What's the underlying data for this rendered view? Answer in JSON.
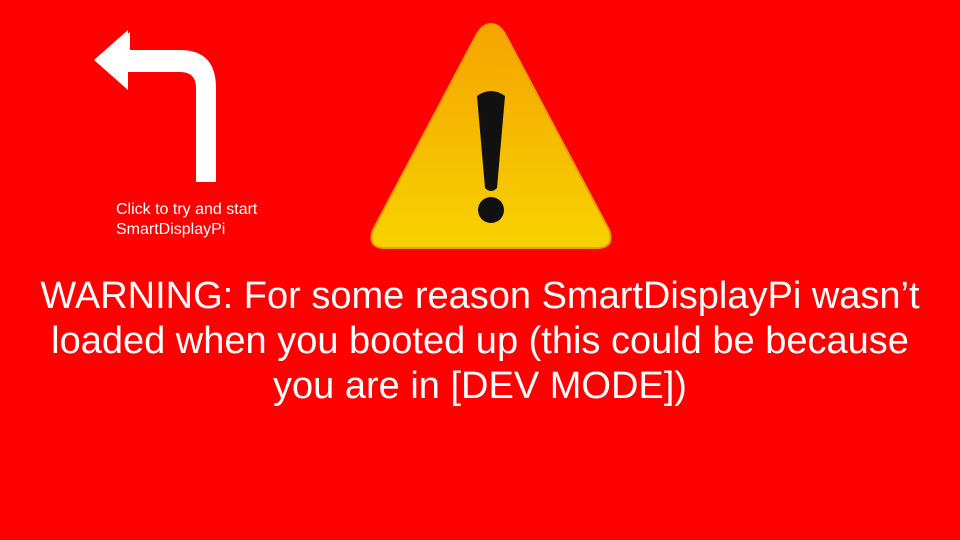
{
  "back_button": {
    "icon": "turn-left-arrow-icon"
  },
  "hint": {
    "text": "Click to try and start\nSmartDisplayPi"
  },
  "warning_icon": {
    "icon": "warning-triangle-icon"
  },
  "message": {
    "text": "WARNING: For some reason SmartDisplayPi wasn’t loaded when you booted up (this could be because you are in [DEV MODE])"
  },
  "colors": {
    "background": "#ff0000",
    "text": "#ffffff",
    "warning_yellow": "#f5c400",
    "warning_orange": "#f5a800",
    "exclamation": "#111111"
  }
}
